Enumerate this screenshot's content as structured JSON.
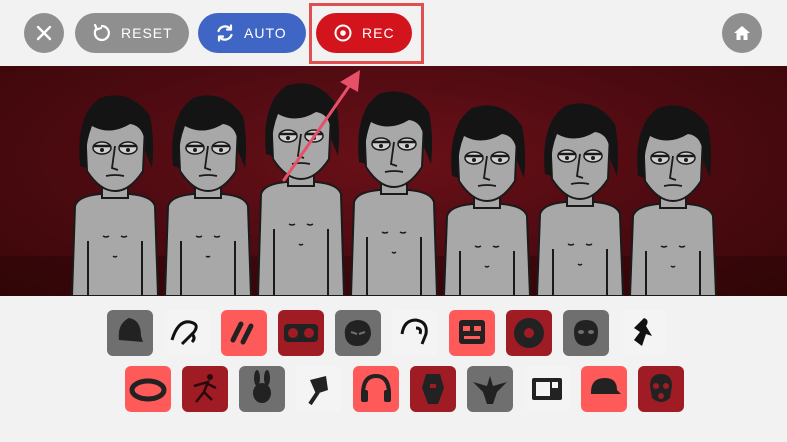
{
  "toolbar": {
    "reset_label": "RESET",
    "auto_label": "AUTO",
    "rec_label": "REC",
    "colors": {
      "gray": "#8f8f8f",
      "auto_blue": "#3f66c4",
      "rec_red": "#d4141c",
      "highlight": "#e05050"
    }
  },
  "palette": {
    "row1": [
      {
        "icon": "bell-shape-icon",
        "tile": "gray"
      },
      {
        "icon": "squiggle-hook-icon",
        "tile": "white"
      },
      {
        "icon": "double-slash-icon",
        "tile": "red"
      },
      {
        "icon": "boombox-icon",
        "tile": "dark"
      },
      {
        "icon": "grumpy-face-icon",
        "tile": "gray"
      },
      {
        "icon": "bird-head-icon",
        "tile": "white"
      },
      {
        "icon": "robot-face-icon",
        "tile": "red"
      },
      {
        "icon": "wheel-icon",
        "tile": "dark"
      },
      {
        "icon": "mask-face-icon",
        "tile": "gray"
      },
      {
        "icon": "dancer-icon",
        "tile": "white"
      }
    ],
    "row2": [
      {
        "icon": "ring-icon",
        "tile": "red"
      },
      {
        "icon": "running-figure-icon",
        "tile": "dark"
      },
      {
        "icon": "bunny-icon",
        "tile": "gray"
      },
      {
        "icon": "magnifier-icon",
        "tile": "white"
      },
      {
        "icon": "headphones-icon",
        "tile": "red"
      },
      {
        "icon": "coffin-icon",
        "tile": "dark"
      },
      {
        "icon": "eagle-icon",
        "tile": "gray"
      },
      {
        "icon": "tv-screen-icon",
        "tile": "white"
      },
      {
        "icon": "cap-icon",
        "tile": "red"
      },
      {
        "icon": "gasmask-icon",
        "tile": "dark"
      }
    ]
  }
}
